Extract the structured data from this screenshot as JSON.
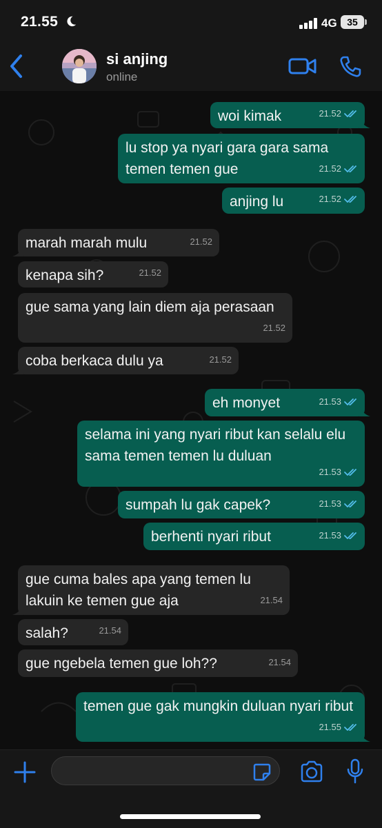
{
  "status_bar": {
    "time": "21.55",
    "network": "4G",
    "battery": "35"
  },
  "header": {
    "contact_name": "si anjing",
    "contact_status": "online"
  },
  "messages": [
    {
      "dir": "out",
      "text": "woi kimak",
      "time": "21.52",
      "read": true
    },
    {
      "dir": "out",
      "text": "lu stop ya nyari gara gara sama temen temen gue",
      "time": "21.52",
      "read": true
    },
    {
      "dir": "out",
      "text": "anjing lu",
      "time": "21.52",
      "read": true
    },
    {
      "dir": "in",
      "text": "marah marah mulu",
      "time": "21.52"
    },
    {
      "dir": "in",
      "text": "kenapa sih?",
      "time": "21.52"
    },
    {
      "dir": "in",
      "text": "gue sama yang lain diem aja perasaan",
      "time": "21.52"
    },
    {
      "dir": "in",
      "text": "coba berkaca dulu ya",
      "time": "21.52"
    },
    {
      "dir": "out",
      "text": "eh monyet",
      "time": "21.53",
      "read": true
    },
    {
      "dir": "out",
      "text": "selama ini yang nyari ribut kan selalu elu sama temen temen lu duluan",
      "time": "21.53",
      "read": true
    },
    {
      "dir": "out",
      "text": "sumpah lu gak capek?",
      "time": "21.53",
      "read": true
    },
    {
      "dir": "out",
      "text": "berhenti nyari ribut",
      "time": "21.53",
      "read": true
    },
    {
      "dir": "in",
      "text": "gue cuma bales apa yang temen lu lakuin ke temen gue aja",
      "time": "21.54"
    },
    {
      "dir": "in",
      "text": "salah?",
      "time": "21.54"
    },
    {
      "dir": "in",
      "text": "gue ngebela temen gue loh??",
      "time": "21.54"
    },
    {
      "dir": "out",
      "text": "temen gue gak mungkin duluan nyari ribut",
      "time": "21.55",
      "read": true
    }
  ],
  "input": {
    "value": "",
    "placeholder": ""
  },
  "colors": {
    "accent": "#2f80ed",
    "outgoing_bubble": "#075e50",
    "incoming_bubble": "#262626",
    "read_ticks": "#53bdeb"
  },
  "icons": [
    "moon-icon",
    "back-chevron-icon",
    "video-call-icon",
    "phone-icon",
    "double-check-icon",
    "plus-icon",
    "sticker-icon",
    "camera-icon",
    "microphone-icon"
  ]
}
